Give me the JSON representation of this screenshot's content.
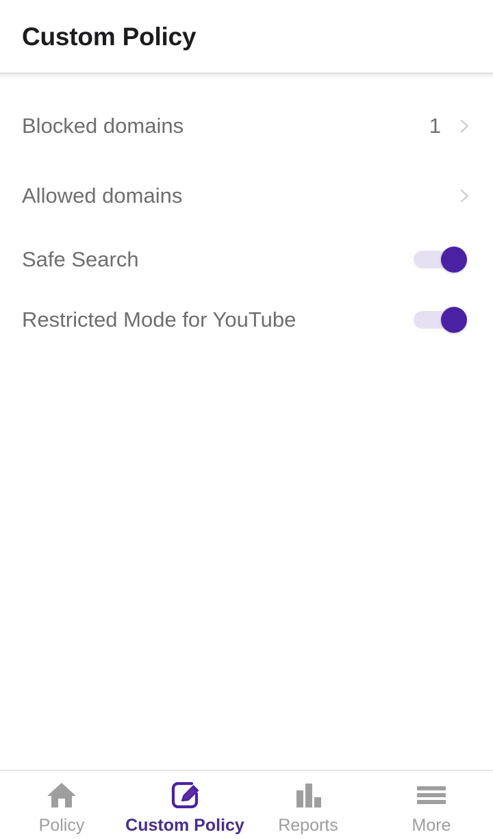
{
  "header": {
    "title": "Custom Policy"
  },
  "settings": {
    "rows": [
      {
        "label": "Blocked domains",
        "value": "1",
        "type": "link",
        "chevron": "chevron-right-icon"
      },
      {
        "label": "Allowed domains",
        "value": "",
        "type": "link",
        "chevron": "chevron-right-icon"
      },
      {
        "label": "Safe Search",
        "state": "on",
        "type": "toggle"
      },
      {
        "label": "Restricted Mode for YouTube",
        "state": "on",
        "type": "toggle"
      }
    ]
  },
  "bottom_nav": {
    "items": [
      {
        "label": "Policy",
        "icon": "home-icon",
        "active": false
      },
      {
        "label": "Custom Policy",
        "icon": "edit-square-icon",
        "active": true
      },
      {
        "label": "Reports",
        "icon": "bar-chart-icon",
        "active": false
      },
      {
        "label": "More",
        "icon": "menu-icon",
        "active": false
      }
    ]
  },
  "colors": {
    "accent_purple": "#4b21a3",
    "accent_label": "#4a2d8c",
    "toggle_track": "#e6e1f2",
    "label_gray": "#6e6e6e",
    "nav_inactive": "#9e9e9e",
    "title_dark": "#1c1c1e"
  }
}
